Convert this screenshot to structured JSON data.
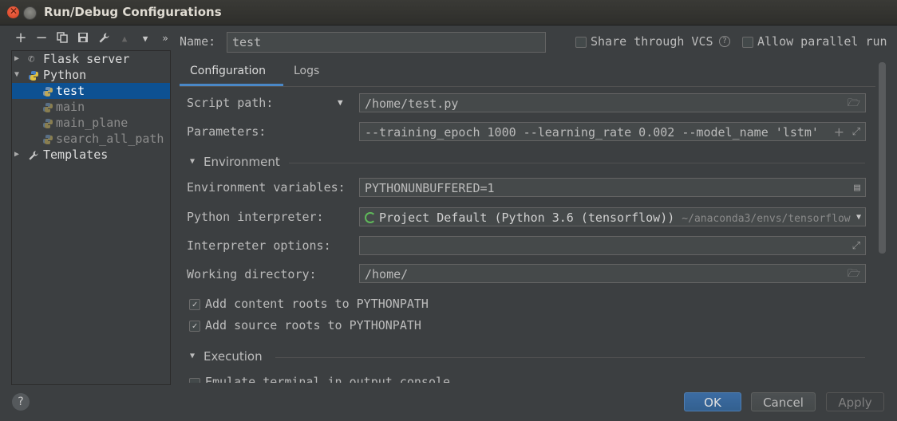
{
  "window": {
    "title": "Run/Debug Configurations"
  },
  "toolbar": {
    "icons": [
      "plus-icon",
      "minus-icon",
      "copy-icon",
      "save-icon",
      "wrench-icon",
      "arrow-up-icon",
      "arrow-down-icon",
      "more-icon"
    ]
  },
  "tree": {
    "flask": "Flask server",
    "python": "Python",
    "children": [
      "test",
      "main",
      "main_plane",
      "search_all_path"
    ],
    "templates": "Templates"
  },
  "name": {
    "label": "Name:",
    "value": "test"
  },
  "share_vcs": {
    "label": "Share through VCS",
    "checked": false
  },
  "allow_parallel": {
    "label": "Allow parallel run",
    "checked": false
  },
  "tabs": [
    "Configuration",
    "Logs"
  ],
  "script_path": {
    "label": "Script path:",
    "value": "/home/test.py"
  },
  "parameters": {
    "label": "Parameters:",
    "value": "--training_epoch 1000 --learning_rate 0.002 --model_name 'lstm'"
  },
  "environment": {
    "section": "Environment",
    "env_vars_label": "Environment variables:",
    "env_vars_value": "PYTHONUNBUFFERED=1",
    "interpreter_label": "Python interpreter:",
    "interpreter_value": "Project Default (Python 3.6 (tensorflow))",
    "interpreter_path": "~/anaconda3/envs/tensorflow",
    "interp_options_label": "Interpreter options:",
    "interp_options_value": "",
    "workdir_label": "Working directory:",
    "workdir_value": "/home/",
    "content_roots": "Add content roots to PYTHONPATH",
    "source_roots": "Add source roots to PYTHONPATH"
  },
  "execution": {
    "section": "Execution",
    "emulate": "Emulate terminal in output console"
  },
  "buttons": {
    "help": "?",
    "ok": "OK",
    "cancel": "Cancel",
    "apply": "Apply"
  },
  "colors": {
    "accent": "#365880",
    "selection": "#0d5192",
    "background": "#3c3f41"
  }
}
